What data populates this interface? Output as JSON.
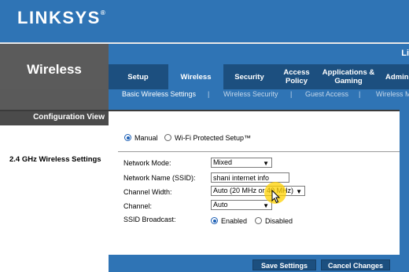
{
  "brand": {
    "logo": "LINKSYS",
    "trademark": "®",
    "product_partial": "Li"
  },
  "section": {
    "title": "Wireless",
    "config_view": "Configuration View",
    "settings_label": "2.4 GHz Wireless Settings"
  },
  "tabs": [
    {
      "label": "Setup"
    },
    {
      "label": "Wireless"
    },
    {
      "label": "Security"
    },
    {
      "label": "Access Policy"
    },
    {
      "label": "Applications & Gaming"
    },
    {
      "label": "Admin"
    }
  ],
  "subtabs": [
    {
      "label": "Basic Wireless Settings"
    },
    {
      "label": "Wireless Security"
    },
    {
      "label": "Guest Access"
    },
    {
      "label": "Wireless M"
    }
  ],
  "separator": "|",
  "mode_selector": {
    "manual": "Manual",
    "wps": "Wi-Fi Protected Setup™",
    "selected": "Manual"
  },
  "form": {
    "network_mode": {
      "label": "Network Mode:",
      "value": "Mixed"
    },
    "ssid": {
      "label": "Network Name (SSID):",
      "value": "shani internet info"
    },
    "channel_width": {
      "label": "Channel Width:",
      "value": "Auto (20 MHz or 40 MHz)"
    },
    "channel": {
      "label": "Channel:",
      "value": "Auto"
    },
    "ssid_broadcast": {
      "label": "SSID Broadcast:",
      "enabled": "Enabled",
      "disabled": "Disabled",
      "selected": "Enabled"
    }
  },
  "buttons": {
    "save": "Save Settings",
    "cancel": "Cancel Changes"
  },
  "colors": {
    "brand_blue": "#2f74b5",
    "dark_blue": "#1c4f7f",
    "panel_gray": "#4a4a4a",
    "highlight": "#ffd200"
  },
  "icons": {
    "chevron": "chevron-down-icon",
    "cursor": "mouse-pointer-icon"
  }
}
